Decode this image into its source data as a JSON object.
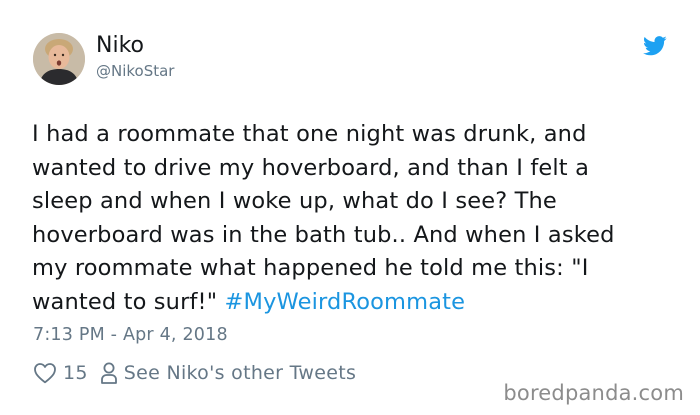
{
  "tweet": {
    "author": {
      "display_name": "Niko",
      "handle": "@NikoStar"
    },
    "text_lines": [
      "I had a roommate that one night was drunk, and",
      "wanted to drive my hoverboard, and than I felt a",
      "sleep and when I woke up, what do I see? The",
      "hoverboard was in the bath tub.. And when I asked",
      "my roommate what happened he told me this: \"I",
      "wanted to surf!\" "
    ],
    "hashtag": "#MyWeirdRoommate",
    "timestamp": "7:13 PM - Apr 4, 2018",
    "like_count": "15",
    "other_tweets_label": "See Niko's other Tweets"
  },
  "watermark": "boredpanda.com",
  "icons": {
    "brand": "twitter-bird-icon",
    "like": "heart-icon",
    "profile": "person-icon"
  },
  "colors": {
    "text": "#14171a",
    "secondary": "#657786",
    "link": "#1b95e0",
    "twitter_blue": "#1da1f2",
    "watermark": "#8c8c8c"
  }
}
